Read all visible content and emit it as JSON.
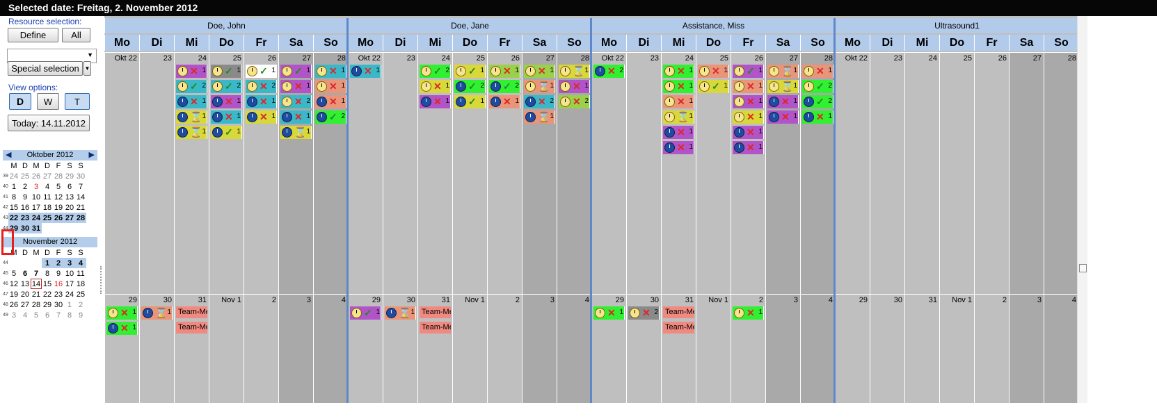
{
  "title": "Selected date: Freitag, 2. November 2012",
  "sidebar": {
    "resource_label": "Resource selection:",
    "define_btn": "Define",
    "all_btn": "All",
    "special_btn": "Special selection",
    "view_label": "View options:",
    "view_d": "D",
    "view_w": "W",
    "view_t": "T",
    "today_btn": "Today: 14.11.2012"
  },
  "weekday_short": [
    "M",
    "D",
    "M",
    "D",
    "F",
    "S",
    "S"
  ],
  "oct": {
    "header": "Oktober 2012",
    "rows": [
      {
        "wk": "39",
        "days": [
          "24",
          "25",
          "26",
          "27",
          "28",
          "29",
          "30"
        ]
      },
      {
        "wk": "40",
        "days": [
          "1",
          "2",
          "3",
          "4",
          "5",
          "6",
          "7"
        ]
      },
      {
        "wk": "41",
        "days": [
          "8",
          "9",
          "10",
          "11",
          "12",
          "13",
          "14"
        ]
      },
      {
        "wk": "42",
        "days": [
          "15",
          "16",
          "17",
          "18",
          "19",
          "20",
          "21"
        ]
      },
      {
        "wk": "43",
        "days": [
          "22",
          "23",
          "24",
          "25",
          "26",
          "27",
          "28"
        ]
      },
      {
        "wk": "44",
        "days": [
          "29",
          "30",
          "31",
          "",
          "",
          "",
          ""
        ]
      }
    ]
  },
  "nov": {
    "header": "November 2012",
    "rows": [
      {
        "wk": "44",
        "days": [
          "",
          "",
          "",
          "1",
          "2",
          "3",
          "4"
        ]
      },
      {
        "wk": "45",
        "days": [
          "5",
          "6",
          "7",
          "8",
          "9",
          "10",
          "11"
        ]
      },
      {
        "wk": "46",
        "days": [
          "12",
          "13",
          "14",
          "15",
          "16",
          "17",
          "18"
        ]
      },
      {
        "wk": "47",
        "days": [
          "19",
          "20",
          "21",
          "22",
          "23",
          "24",
          "25"
        ]
      },
      {
        "wk": "48",
        "days": [
          "26",
          "27",
          "28",
          "29",
          "30",
          "1",
          "2"
        ]
      },
      {
        "wk": "49",
        "days": [
          "3",
          "4",
          "5",
          "6",
          "7",
          "8",
          "9"
        ]
      }
    ]
  },
  "weekday_headers": [
    "Mo",
    "Di",
    "Mi",
    "Do",
    "Fr",
    "Sa",
    "So"
  ],
  "week1_dates": [
    "Okt 22",
    "23",
    "24",
    "25",
    "26",
    "27",
    "28"
  ],
  "week2_dates": [
    "29",
    "30",
    "31",
    "Nov 1",
    "2",
    "3",
    "4"
  ],
  "resources": [
    {
      "name": "Doe, John",
      "w1": [
        [],
        [],
        [
          [
            "#b054c8",
            "y",
            "x",
            "1"
          ],
          [
            "#3ab8c8",
            "y",
            "c",
            "2"
          ],
          [
            "#3ab8c8",
            "b",
            "x",
            "1"
          ],
          [
            "#d8d83a",
            "b",
            "h",
            "1"
          ],
          [
            "#d8d83a",
            "b",
            "h",
            "1"
          ]
        ],
        [
          [
            "#8a8a8a",
            "y",
            "c",
            "1"
          ],
          [
            "#3ab8c8",
            "y",
            "c",
            "2"
          ],
          [
            "#b054c8",
            "b",
            "x",
            "1"
          ],
          [
            "#3ab8c8",
            "b",
            "x",
            "1"
          ],
          [
            "#d8d83a",
            "b",
            "c",
            "1"
          ]
        ],
        [
          [
            "#ffffff",
            "y",
            "c",
            "1"
          ],
          [
            "#3ab8c8",
            "y",
            "x",
            "2"
          ],
          [
            "#3ab8c8",
            "b",
            "x",
            "1"
          ],
          [
            "#d8d83a",
            "b",
            "x",
            "1"
          ]
        ],
        [
          [
            "#b054c8",
            "y",
            "c",
            "1"
          ],
          [
            "#b054c8",
            "y",
            "x",
            "1"
          ],
          [
            "#3ab8c8",
            "y",
            "x",
            "2"
          ],
          [
            "#3ab8c8",
            "b",
            "x",
            "1"
          ],
          [
            "#d8d83a",
            "b",
            "h",
            "1"
          ]
        ],
        [
          [
            "#3ab8c8",
            "y",
            "x",
            "1"
          ],
          [
            "#e8957a",
            "y",
            "x",
            "1"
          ],
          [
            "#e8957a",
            "b",
            "x",
            "1"
          ],
          [
            "#31f031",
            "b",
            "c",
            "2"
          ]
        ]
      ],
      "w2": [
        [
          [
            "#31f031",
            "y",
            "x",
            "1"
          ],
          [
            "#31f031",
            "b",
            "x",
            "1"
          ]
        ],
        [
          [
            "#e8957a",
            "b",
            "h",
            "1"
          ]
        ],
        [
          [
            "team",
            "Team-Me"
          ],
          [
            "team",
            "Team-Me"
          ]
        ],
        [],
        [],
        [],
        []
      ]
    },
    {
      "name": "Doe, Jane",
      "w1": [
        [
          [
            "#3ab8c8",
            "b",
            "x",
            "1"
          ]
        ],
        [],
        [
          [
            "#31f031",
            "y",
            "c",
            "2"
          ],
          [
            "#d8d83a",
            "y",
            "x",
            "1"
          ],
          [
            "#b054c8",
            "b",
            "x",
            "1"
          ]
        ],
        [
          [
            "#d8d83a",
            "y",
            "c",
            "1"
          ],
          [
            "#31f031",
            "b",
            "c",
            "2"
          ],
          [
            "#d8d83a",
            "b",
            "c",
            "1"
          ]
        ],
        [
          [
            "#9ad04a",
            "y",
            "x",
            "1"
          ],
          [
            "#31f031",
            "b",
            "c",
            "2"
          ],
          [
            "#e8957a",
            "b",
            "x",
            "1"
          ]
        ],
        [
          [
            "#9ad04a",
            "y",
            "x",
            "1"
          ],
          [
            "#e8957a",
            "y",
            "h",
            "1"
          ],
          [
            "#3ab8c8",
            "b",
            "x",
            "2"
          ],
          [
            "#e8957a",
            "b",
            "h",
            "1"
          ]
        ],
        [
          [
            "#d8d83a",
            "y",
            "h",
            "1"
          ],
          [
            "#b054c8",
            "y",
            "x",
            "1"
          ],
          [
            "#9ad04a",
            "y",
            "x",
            "2"
          ]
        ]
      ],
      "w2": [
        [
          [
            "#b054c8",
            "y",
            "c",
            "1"
          ]
        ],
        [
          [
            "#e8957a",
            "b",
            "h",
            "1"
          ]
        ],
        [
          [
            "team",
            "Team-Me"
          ],
          [
            "team",
            "Team-Me"
          ]
        ],
        [],
        [],
        [],
        []
      ]
    },
    {
      "name": "Assistance, Miss",
      "w1": [
        [
          [
            "#31f031",
            "b",
            "x",
            "2"
          ]
        ],
        [],
        [
          [
            "#31f031",
            "y",
            "x",
            "1"
          ],
          [
            "#31f031",
            "y",
            "x",
            "1"
          ],
          [
            "#e8957a",
            "y",
            "x",
            "1"
          ],
          [
            "#d8d83a",
            "y",
            "h",
            "1"
          ],
          [
            "#b054c8",
            "b",
            "x",
            "1"
          ],
          [
            "#b054c8",
            "b",
            "x",
            "1"
          ]
        ],
        [
          [
            "#e8957a",
            "y",
            "x",
            "1"
          ],
          [
            "#d8d83a",
            "y",
            "c",
            "1"
          ]
        ],
        [
          [
            "#b054c8",
            "y",
            "c",
            "1"
          ],
          [
            "#e8957a",
            "y",
            "x",
            "1"
          ],
          [
            "#b054c8",
            "y",
            "x",
            "1"
          ],
          [
            "#d8d83a",
            "y",
            "x",
            "1"
          ],
          [
            "#b054c8",
            "b",
            "x",
            "1"
          ],
          [
            "#b054c8",
            "b",
            "x",
            "1"
          ]
        ],
        [
          [
            "#e8957a",
            "y",
            "h",
            "1"
          ],
          [
            "#d8d83a",
            "y",
            "h",
            "1"
          ],
          [
            "#b054c8",
            "b",
            "x",
            "1"
          ],
          [
            "#b054c8",
            "b",
            "x",
            "1"
          ]
        ],
        [
          [
            "#e8957a",
            "y",
            "x",
            "1"
          ],
          [
            "#31f031",
            "y",
            "c",
            "2"
          ],
          [
            "#31f031",
            "b",
            "c",
            "2"
          ],
          [
            "#31f031",
            "b",
            "x",
            "1"
          ]
        ]
      ],
      "w2": [
        [
          [
            "#31f031",
            "y",
            "x",
            "1"
          ]
        ],
        [
          [
            "#8a8a8a",
            "y",
            "x",
            "2"
          ]
        ],
        [
          [
            "team",
            "Team-Me"
          ],
          [
            "team",
            "Team-Me"
          ]
        ],
        [],
        [
          [
            "#31f031",
            "y",
            "x",
            "1"
          ]
        ],
        [],
        []
      ]
    },
    {
      "name": "Ultrasound1",
      "w1": [
        [],
        [],
        [],
        [],
        [],
        [],
        []
      ],
      "w2": [
        [],
        [],
        [],
        [],
        [],
        [],
        []
      ]
    }
  ]
}
